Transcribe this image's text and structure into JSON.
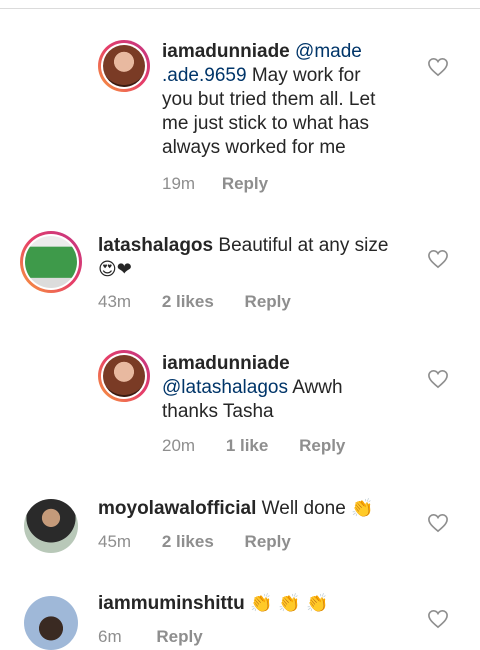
{
  "comments": [
    {
      "username": "iamadunniade",
      "mention": "@made\n.ade.9659",
      "mention_line1": "@made",
      "mention_line2": ".ade.9659",
      "text_line1": "May work for",
      "text_line2": "you but tried them all. Let",
      "text_line3": "me just stick to what has",
      "text_line4": "always worked for me",
      "time": "19m",
      "reply": "Reply"
    },
    {
      "username": "latashalagos",
      "text": "Beautiful at any size",
      "emojis": "😍❤",
      "time": "43m",
      "likes": "2 likes",
      "reply": "Reply"
    },
    {
      "username": "iamadunniade",
      "mention": "@latashalagos",
      "text_line1": "Awwh",
      "text_line2": "thanks Tasha",
      "time": "20m",
      "likes": "1 like",
      "reply": "Reply"
    },
    {
      "username": "moyolawalofficial",
      "text": "Well done",
      "emojis": "👏",
      "time": "45m",
      "likes": "2 likes",
      "reply": "Reply"
    },
    {
      "username": "iammuminshittu",
      "emojis": "👏 👏 👏",
      "time": "6m",
      "reply": "Reply"
    }
  ],
  "icons": {
    "like": "heart-outline-icon"
  },
  "colors": {
    "mention": "#003569",
    "meta": "#8e8e8e",
    "text": "#262626",
    "ring_start": "#f9a03a",
    "ring_end": "#c13584"
  }
}
